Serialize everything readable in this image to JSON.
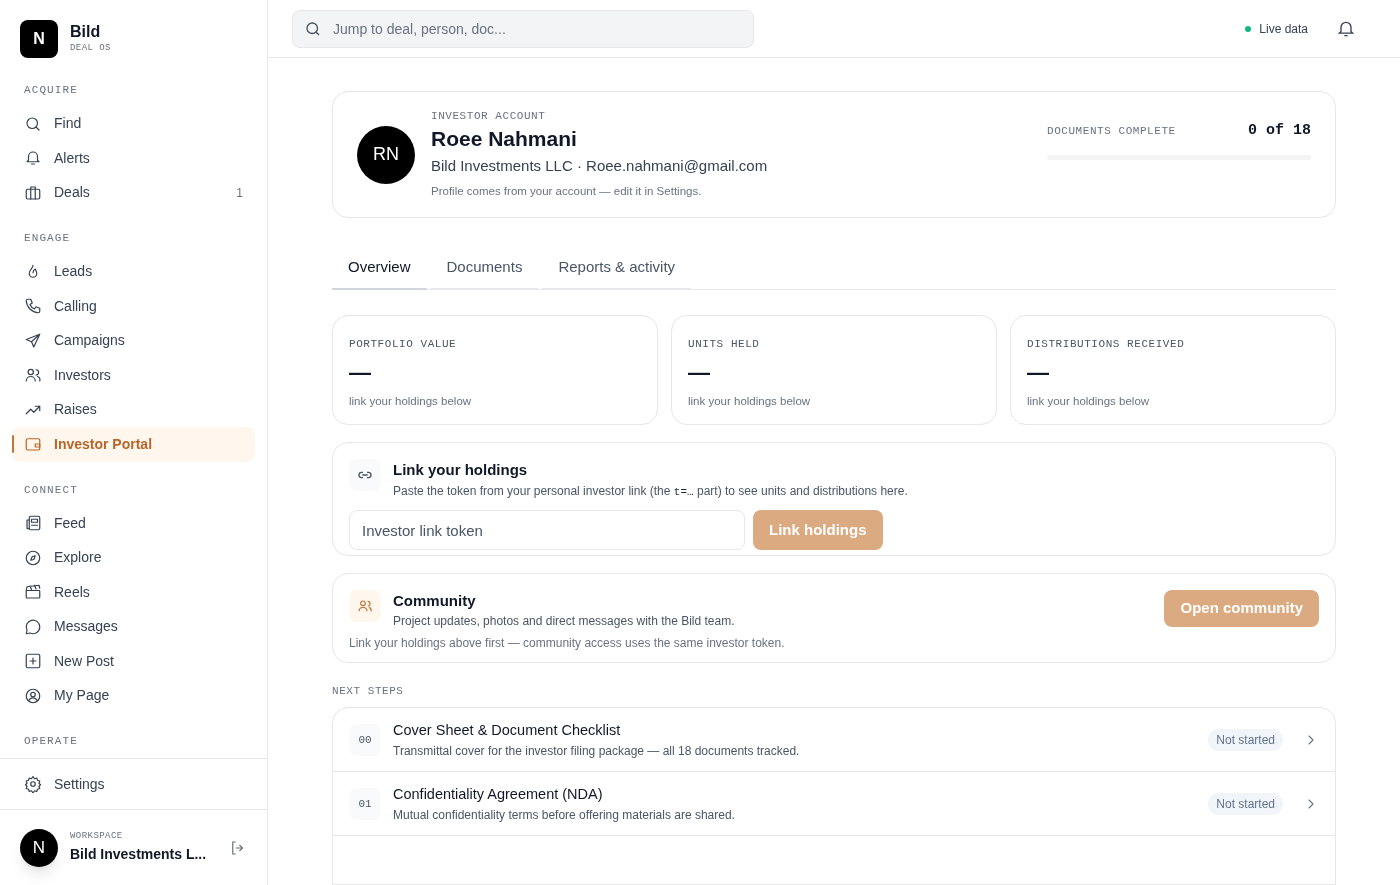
{
  "brand": {
    "logo_letter": "N",
    "name": "Bild",
    "tagline": "DEAL OS"
  },
  "sidebar": {
    "sections": [
      {
        "title": "ACQUIRE",
        "items": [
          {
            "label": "Find",
            "selected": false
          },
          {
            "label": "Alerts",
            "selected": false
          },
          {
            "label": "Deals",
            "count": "1",
            "selected": false
          }
        ]
      },
      {
        "title": "ENGAGE",
        "items": [
          {
            "label": "Leads",
            "selected": false
          },
          {
            "label": "Calling",
            "selected": false
          },
          {
            "label": "Campaigns",
            "selected": false
          },
          {
            "label": "Investors",
            "selected": false
          },
          {
            "label": "Raises",
            "selected": false
          },
          {
            "label": "Investor Portal",
            "selected": true
          }
        ]
      },
      {
        "title": "CONNECT",
        "items": [
          {
            "label": "Feed",
            "selected": false
          },
          {
            "label": "Explore",
            "selected": false
          },
          {
            "label": "Reels",
            "selected": false
          },
          {
            "label": "Messages",
            "selected": false
          },
          {
            "label": "New Post",
            "selected": false
          },
          {
            "label": "My Page",
            "selected": false
          }
        ]
      },
      {
        "title": "OPERATE"
      }
    ],
    "settings": "Settings",
    "workspace": {
      "avatar": "N",
      "label": "WORKSPACE",
      "name": "Bild Investments L..."
    }
  },
  "topbar": {
    "search_placeholder": "Jump to deal, person, doc...",
    "live": {
      "label": "Live data",
      "color": "#10b981"
    }
  },
  "profile": {
    "avatar": "RN",
    "eyebrow": "INVESTOR ACCOUNT",
    "name": "Roee Nahmani",
    "subtitle": "Bild Investments LLC · Roee.nahmani@gmail.com",
    "note": "Profile comes from your account — edit it in Settings.",
    "docs_label": "DOCUMENTS COMPLETE",
    "docs_count": "0 of 18",
    "level": 0
  },
  "tabs": [
    {
      "label": "Overview",
      "selected": true
    },
    {
      "label": "Documents",
      "selected": false
    },
    {
      "label": "Reports & activity",
      "selected": false
    }
  ],
  "stats": [
    {
      "label": "PORTFOLIO VALUE",
      "value": "—",
      "hint": "link your holdings below"
    },
    {
      "label": "UNITS HELD",
      "value": "—",
      "hint": "link your holdings below"
    },
    {
      "label": "DISTRIBUTIONS RECEIVED",
      "value": "—",
      "hint": "link your holdings below"
    }
  ],
  "link_holdings": {
    "title": "Link your holdings",
    "description_before": "Paste the token from your personal investor link (the",
    "code": "t=…",
    "description_after": "part) to see units and distributions here.",
    "placeholder": "Investor link token",
    "button": {
      "label": "Link holdings",
      "disabled": true
    }
  },
  "community": {
    "title": "Community",
    "description": "Project updates, photos and direct messages with the Bild team.",
    "note": "Link your holdings above first — community access uses the same investor token.",
    "button": {
      "label": "Open community",
      "disabled": true
    }
  },
  "next_steps": {
    "title": "NEXT STEPS",
    "steps": [
      {
        "number": "00",
        "title": "Cover Sheet & Document Checklist",
        "description": "Transmittal cover for the investor filing package — all 18 documents tracked.",
        "status": "Not started"
      },
      {
        "number": "01",
        "title": "Confidentiality Agreement (NDA)",
        "description": "Mutual confidentiality terms before offering materials are shared.",
        "status": "Not started"
      }
    ]
  }
}
